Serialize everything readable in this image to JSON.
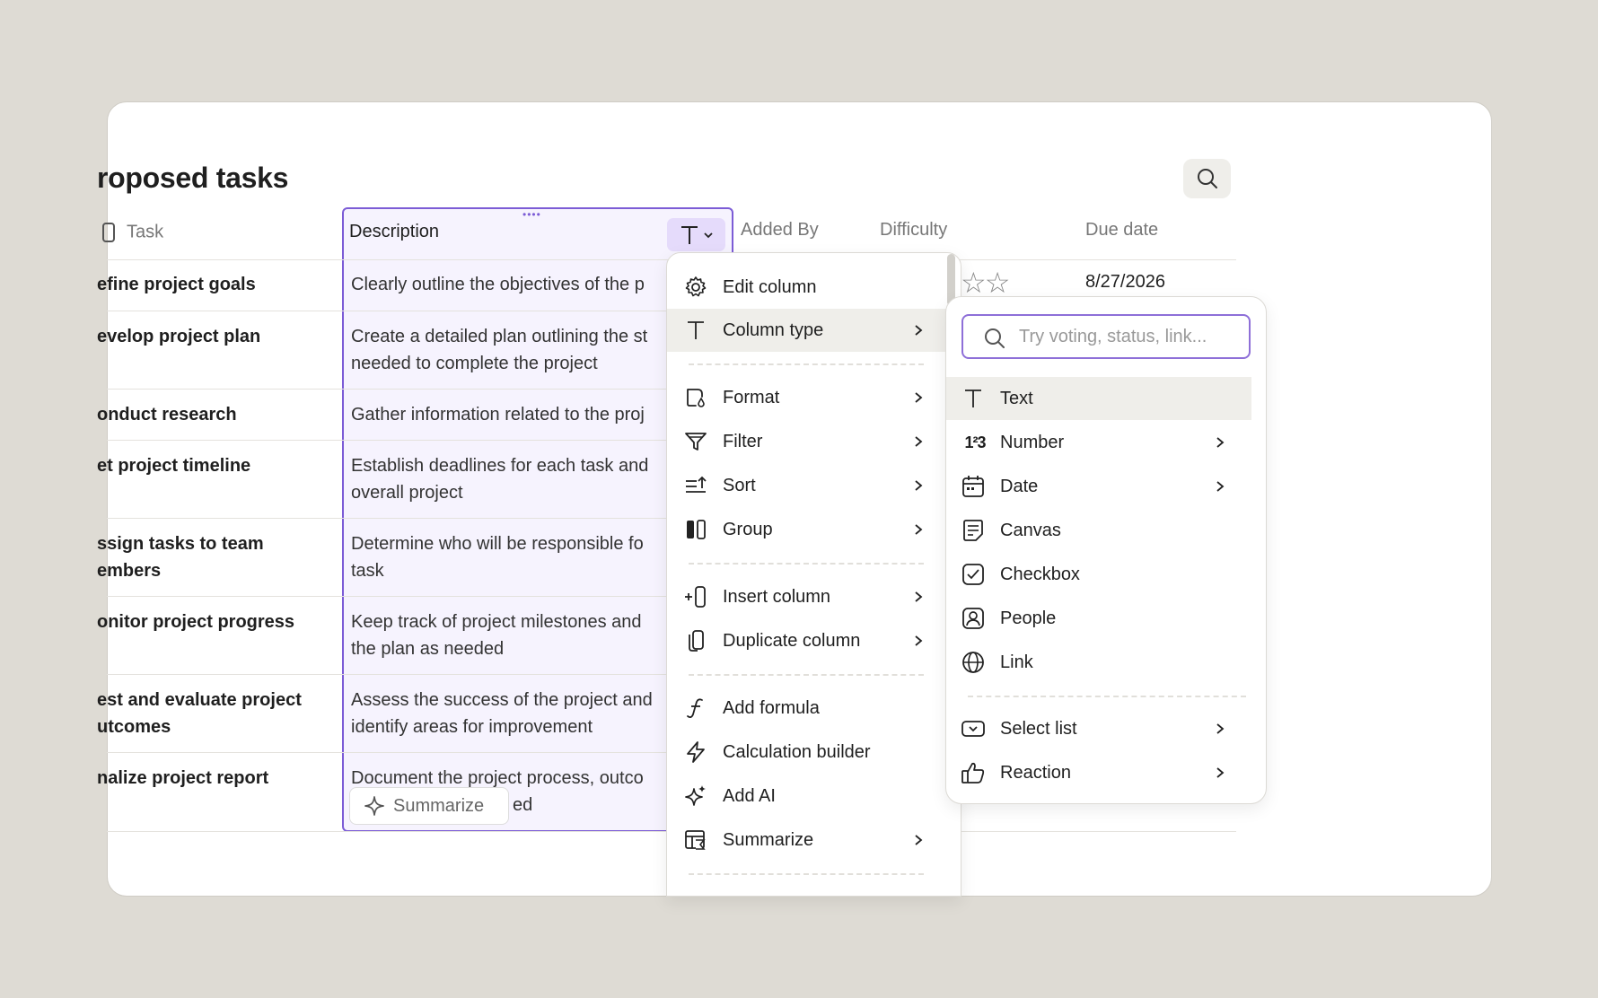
{
  "page": {
    "title": "roposed tasks"
  },
  "columns": {
    "task": "Task",
    "description": "Description",
    "added_by": "Added By",
    "difficulty": "Difficulty",
    "due_date": "Due date"
  },
  "rows": [
    {
      "task": [
        "efine project goals"
      ],
      "description": [
        "Clearly outline the objectives of the p"
      ],
      "due_date": "8/27/2026",
      "difficulty_stars": "☆☆"
    },
    {
      "task": [
        "evelop project plan"
      ],
      "description": [
        "Create a detailed plan outlining the st",
        "needed to complete the project"
      ]
    },
    {
      "task": [
        "onduct research"
      ],
      "description": [
        "Gather information related to the proj"
      ]
    },
    {
      "task": [
        "et project timeline"
      ],
      "description": [
        "Establish deadlines for each task and",
        "overall project"
      ]
    },
    {
      "task": [
        "ssign tasks to team",
        "embers"
      ],
      "description": [
        "Determine who will be responsible fo",
        "task"
      ]
    },
    {
      "task": [
        "onitor project progress"
      ],
      "description": [
        "Keep track of project milestones and",
        "the plan as needed"
      ]
    },
    {
      "task": [
        "est and evaluate project",
        "utcomes"
      ],
      "description": [
        "Assess the success of the project and",
        "identify areas for improvement"
      ]
    },
    {
      "task": [
        "nalize project report"
      ],
      "description": [
        "Document the project process, outco",
        "ed"
      ]
    }
  ],
  "summarize_button": "Summarize",
  "column_menu": {
    "items": [
      {
        "label": "Edit column",
        "icon": "gear-icon"
      },
      {
        "label": "Column type",
        "icon": "text-type-icon",
        "has_submenu": true,
        "active": true
      },
      {
        "label": "Format",
        "icon": "format-icon",
        "has_submenu": true
      },
      {
        "label": "Filter",
        "icon": "filter-icon",
        "has_submenu": true
      },
      {
        "label": "Sort",
        "icon": "sort-icon",
        "has_submenu": true
      },
      {
        "label": "Group",
        "icon": "group-icon",
        "has_submenu": true
      },
      {
        "label": "Insert column",
        "icon": "insert-column-icon",
        "has_submenu": true
      },
      {
        "label": "Duplicate column",
        "icon": "duplicate-icon",
        "has_submenu": true
      },
      {
        "label": "Add formula",
        "icon": "formula-icon"
      },
      {
        "label": "Calculation builder",
        "icon": "lightning-icon"
      },
      {
        "label": "Add AI",
        "icon": "sparkle-icon"
      },
      {
        "label": "Summarize",
        "icon": "summarize-icon",
        "has_submenu": true
      }
    ]
  },
  "type_menu": {
    "search_placeholder": "Try voting, status, link...",
    "items": [
      {
        "label": "Text",
        "icon": "text-icon",
        "active": true
      },
      {
        "label": "Number",
        "icon": "number-icon",
        "has_submenu": true
      },
      {
        "label": "Date",
        "icon": "calendar-icon",
        "has_submenu": true
      },
      {
        "label": "Canvas",
        "icon": "canvas-icon"
      },
      {
        "label": "Checkbox",
        "icon": "checkbox-icon"
      },
      {
        "label": "People",
        "icon": "people-icon"
      },
      {
        "label": "Link",
        "icon": "globe-icon"
      },
      {
        "label": "Select list",
        "icon": "select-list-icon",
        "has_submenu": true
      },
      {
        "label": "Reaction",
        "icon": "thumbs-up-icon",
        "has_submenu": true
      }
    ]
  },
  "colors": {
    "accent": "#7c5cd6",
    "accent_bg": "#f6f3fe",
    "background": "#dedbd4"
  }
}
